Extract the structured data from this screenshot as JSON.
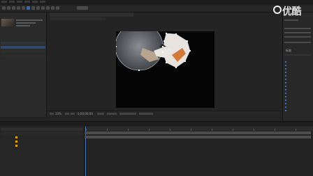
{
  "watermark": {
    "text": "优酷"
  },
  "composition": {
    "zoom": "33%",
    "current_time": "0;00;00;00"
  },
  "right_panel": {
    "workspace_label": "标准"
  },
  "colors": {
    "accent": "#3f74b8",
    "playhead": "#3f74b8",
    "layer_swatch": "#d9a521"
  },
  "icons": [
    "selection-tool-icon",
    "hand-tool-icon",
    "zoom-tool-icon",
    "rotate-tool-icon",
    "camera-tool-icon",
    "pan-behind-icon",
    "mask-tool-icon",
    "pen-tool-icon",
    "text-tool-icon",
    "brush-tool-icon",
    "clone-stamp-icon",
    "eraser-icon",
    "puppet-pin-icon"
  ]
}
